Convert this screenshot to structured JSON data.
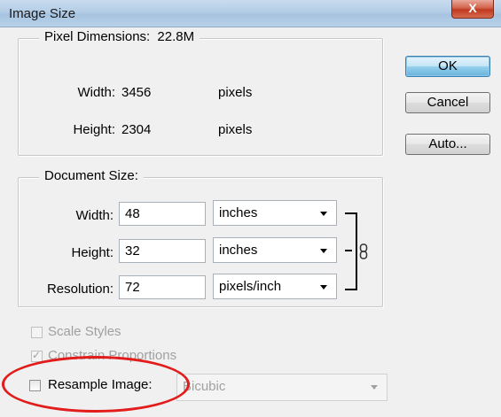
{
  "window": {
    "title": "Image Size",
    "close_glyph": "X"
  },
  "pixel_dimensions": {
    "legend": "Pixel Dimensions:",
    "size": "22.8M",
    "width_label": "Width:",
    "width_value": "3456",
    "width_unit": "pixels",
    "height_label": "Height:",
    "height_value": "2304",
    "height_unit": "pixels"
  },
  "document_size": {
    "legend": "Document Size:",
    "width_label": "Width:",
    "width_value": "48",
    "width_unit": "inches",
    "height_label": "Height:",
    "height_value": "32",
    "height_unit": "inches",
    "resolution_label": "Resolution:",
    "resolution_value": "72",
    "resolution_unit": "pixels/inch"
  },
  "buttons": {
    "ok": "OK",
    "cancel": "Cancel",
    "auto": "Auto..."
  },
  "options": {
    "scale_styles": "Scale Styles",
    "constrain_proportions": "Constrain Proportions",
    "resample_image": "Resample Image:",
    "resample_method": "Bicubic",
    "check_glyph": "✓"
  },
  "colors": {
    "highlight_ellipse": "#e21b1b",
    "ok_button_accent": "#3c7fb1"
  }
}
